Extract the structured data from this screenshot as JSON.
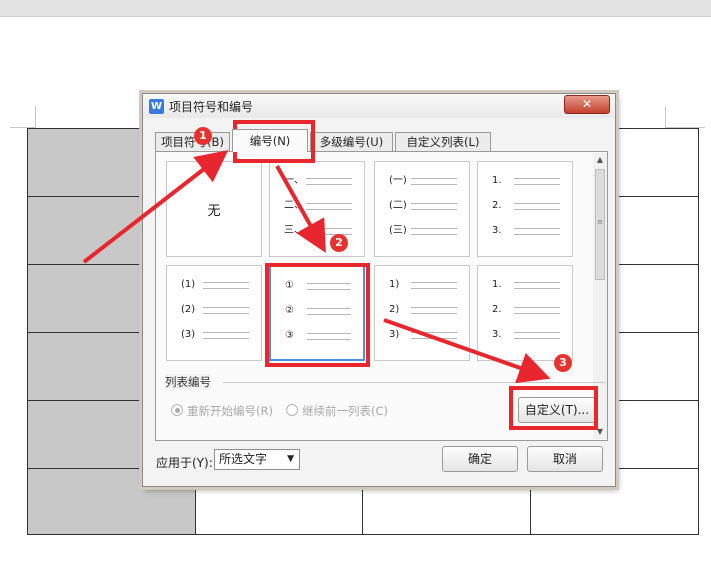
{
  "dialog": {
    "title": "项目符号和编号",
    "logo_letter": "W",
    "close": "✕",
    "tabs": [
      {
        "label": "项目符号(B)"
      },
      {
        "label": "编号(N)"
      },
      {
        "label": "多级编号(U)"
      },
      {
        "label": "自定义列表(L)"
      }
    ],
    "active_tab": 1,
    "gallery": {
      "none_label": "无",
      "tiles": [
        {
          "markers": []
        },
        {
          "markers": [
            "一、",
            "二、",
            "三、"
          ]
        },
        {
          "markers": [
            "(一)",
            "(二)",
            "(三)"
          ]
        },
        {
          "markers": [
            "1.",
            "2.",
            "3."
          ]
        },
        {
          "markers": [
            "(1)",
            "(2)",
            "(3)"
          ]
        },
        {
          "markers": [
            "①",
            "②",
            "③"
          ]
        },
        {
          "markers": [
            "1)",
            "2)",
            "3)"
          ]
        },
        {
          "markers": [
            "1.",
            "2.",
            "3."
          ]
        }
      ],
      "selected_index": 5
    },
    "list_numbering": {
      "section_label": "列表编号",
      "restart": "重新开始编号(R)",
      "continue": "继续前一列表(C)",
      "custom_button": "自定义(T)..."
    },
    "apply_to": {
      "label": "应用于(Y):",
      "value": "所选文字"
    },
    "ok": "确定",
    "cancel": "取消"
  },
  "annotations": [
    "1",
    "2",
    "3"
  ],
  "colors": {
    "annotation_red": "#e8262e",
    "selection_blue": "#4a90e2"
  }
}
